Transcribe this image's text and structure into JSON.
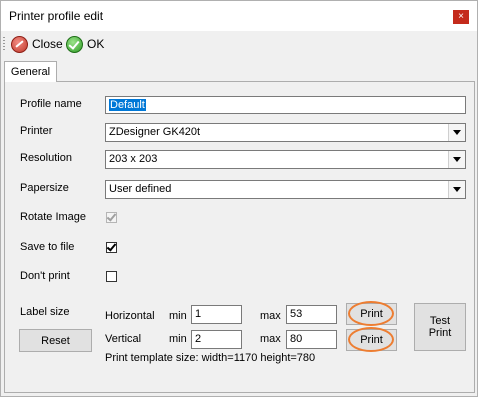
{
  "window": {
    "title": "Printer profile edit",
    "close_glyph": "×"
  },
  "toolbar": {
    "close_label": "Close",
    "ok_label": "OK"
  },
  "tabs": [
    {
      "label": "General"
    }
  ],
  "form": {
    "profile_name": {
      "label": "Profile name",
      "value": "Default"
    },
    "printer": {
      "label": "Printer",
      "value": "ZDesigner GK420t"
    },
    "resolution": {
      "label": "Resolution",
      "value": "203 x 203"
    },
    "papersize": {
      "label": "Papersize",
      "value": "User defined"
    },
    "rotate_image": {
      "label": "Rotate Image",
      "checked": true,
      "enabled": false
    },
    "save_to_file": {
      "label": "Save to file",
      "checked": true,
      "enabled": true
    },
    "dont_print": {
      "label": "Don't print",
      "checked": false,
      "enabled": true
    },
    "label_size": {
      "label": "Label size",
      "reset_label": "Reset",
      "horizontal": {
        "label": "Horizontal",
        "min_label": "min",
        "min": "1",
        "max_label": "max",
        "max": "53",
        "print_label": "Print"
      },
      "vertical": {
        "label": "Vertical",
        "min_label": "min",
        "min": "2",
        "max_label": "max",
        "max": "80",
        "print_label": "Print"
      },
      "test_print_label": "Test Print",
      "template_size_text": "Print template size: width=1170 height=780"
    }
  },
  "colors": {
    "highlight_oval": "#ed7d31",
    "selection": "#0078d7"
  }
}
